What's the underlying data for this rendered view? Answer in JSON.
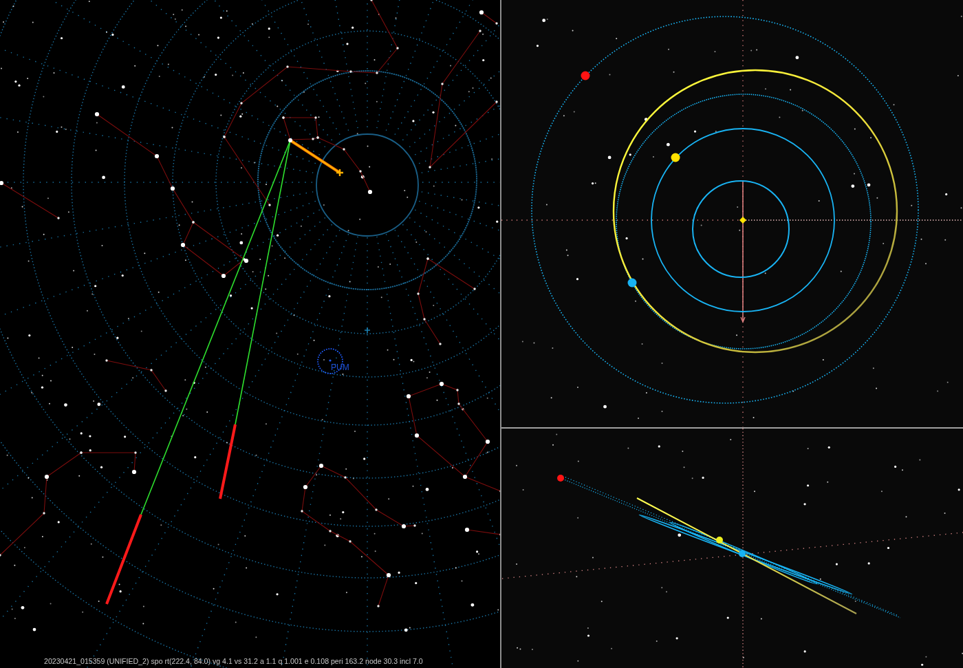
{
  "sky_view": {
    "radiant_label": "PUM"
  },
  "status_bar": {
    "text": "20230421_015359 (UNIFIED_2) spo rt(222.4, 84.0) vg 4.1 vs 31.2 a 1.1 q 1.001 e 0.108 peri 163.2 node 30.3 incl 7.0"
  },
  "orbit_view": {
    "bodies": [
      {
        "color": "#ff1414"
      },
      {
        "color": "#ffe100"
      },
      {
        "color": "#18b2f2"
      }
    ]
  },
  "side_view": {
    "bodies": [
      {
        "color": "#ff1414"
      },
      {
        "color": "#eef01e"
      },
      {
        "color": "#18b2f2"
      }
    ]
  }
}
